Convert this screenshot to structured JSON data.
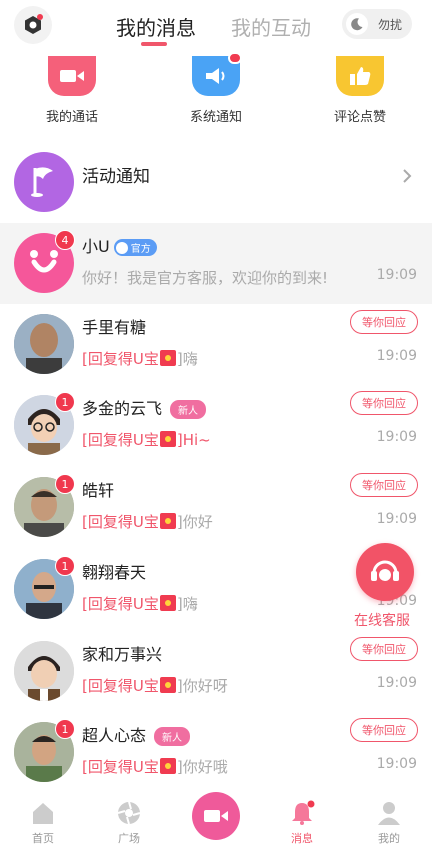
{
  "header": {
    "tabs": [
      {
        "label": "我的消息",
        "active": true
      },
      {
        "label": "我的互动",
        "active": false
      }
    ],
    "dnd_label": "勿扰"
  },
  "quick_actions": [
    {
      "label": "我的通话",
      "icon": "video-icon",
      "color": "#f5607a"
    },
    {
      "label": "系统通知",
      "icon": "speaker-icon",
      "color": "#4aa3f5"
    },
    {
      "label": "评论点赞",
      "icon": "thumbs-up-icon",
      "color": "#f8c631"
    }
  ],
  "activity": {
    "label": "活动通知"
  },
  "conversations": [
    {
      "name": "小U",
      "tag": "官方",
      "badge": "4",
      "preview": "你好！我是官方客服，欢迎你的到来!",
      "time": "19:09",
      "status": ""
    },
    {
      "name": "手里有糖",
      "tag": "",
      "badge": "",
      "preview_prefix": "[回复得U宝",
      "preview_suffix": "]嗨",
      "time": "19:09",
      "status": "等你回应"
    },
    {
      "name": "多金的云飞",
      "tag": "新人",
      "badge": "1",
      "preview_prefix": "[回复得U宝",
      "preview_suffix": "]Hi~",
      "time": "19:09",
      "status": "等你回应"
    },
    {
      "name": "皓轩",
      "tag": "",
      "badge": "1",
      "preview_prefix": "[回复得U宝",
      "preview_suffix": "]你好",
      "time": "19:09",
      "status": "等你回应"
    },
    {
      "name": "翱翔春天",
      "tag": "",
      "badge": "1",
      "preview_prefix": "[回复得U宝",
      "preview_suffix": "]嗨",
      "time": "19:09",
      "status": ""
    },
    {
      "name": "家和万事兴",
      "tag": "",
      "badge": "",
      "preview_prefix": "[回复得U宝",
      "preview_suffix": "]你好呀",
      "time": "19:09",
      "status": "等你回应"
    },
    {
      "name": "超人心态",
      "tag": "新人",
      "badge": "1",
      "preview_prefix": "[回复得U宝",
      "preview_suffix": "]你好哦",
      "time": "19:09",
      "status": "等你回应"
    }
  ],
  "online_service": {
    "label": "在线客服"
  },
  "bottom_nav": [
    {
      "label": "首页"
    },
    {
      "label": "广场"
    },
    {
      "label": "消息",
      "active": true
    },
    {
      "label": "我的"
    }
  ],
  "colors": {
    "accent": "#f0566b",
    "badge": "#f0384e"
  }
}
